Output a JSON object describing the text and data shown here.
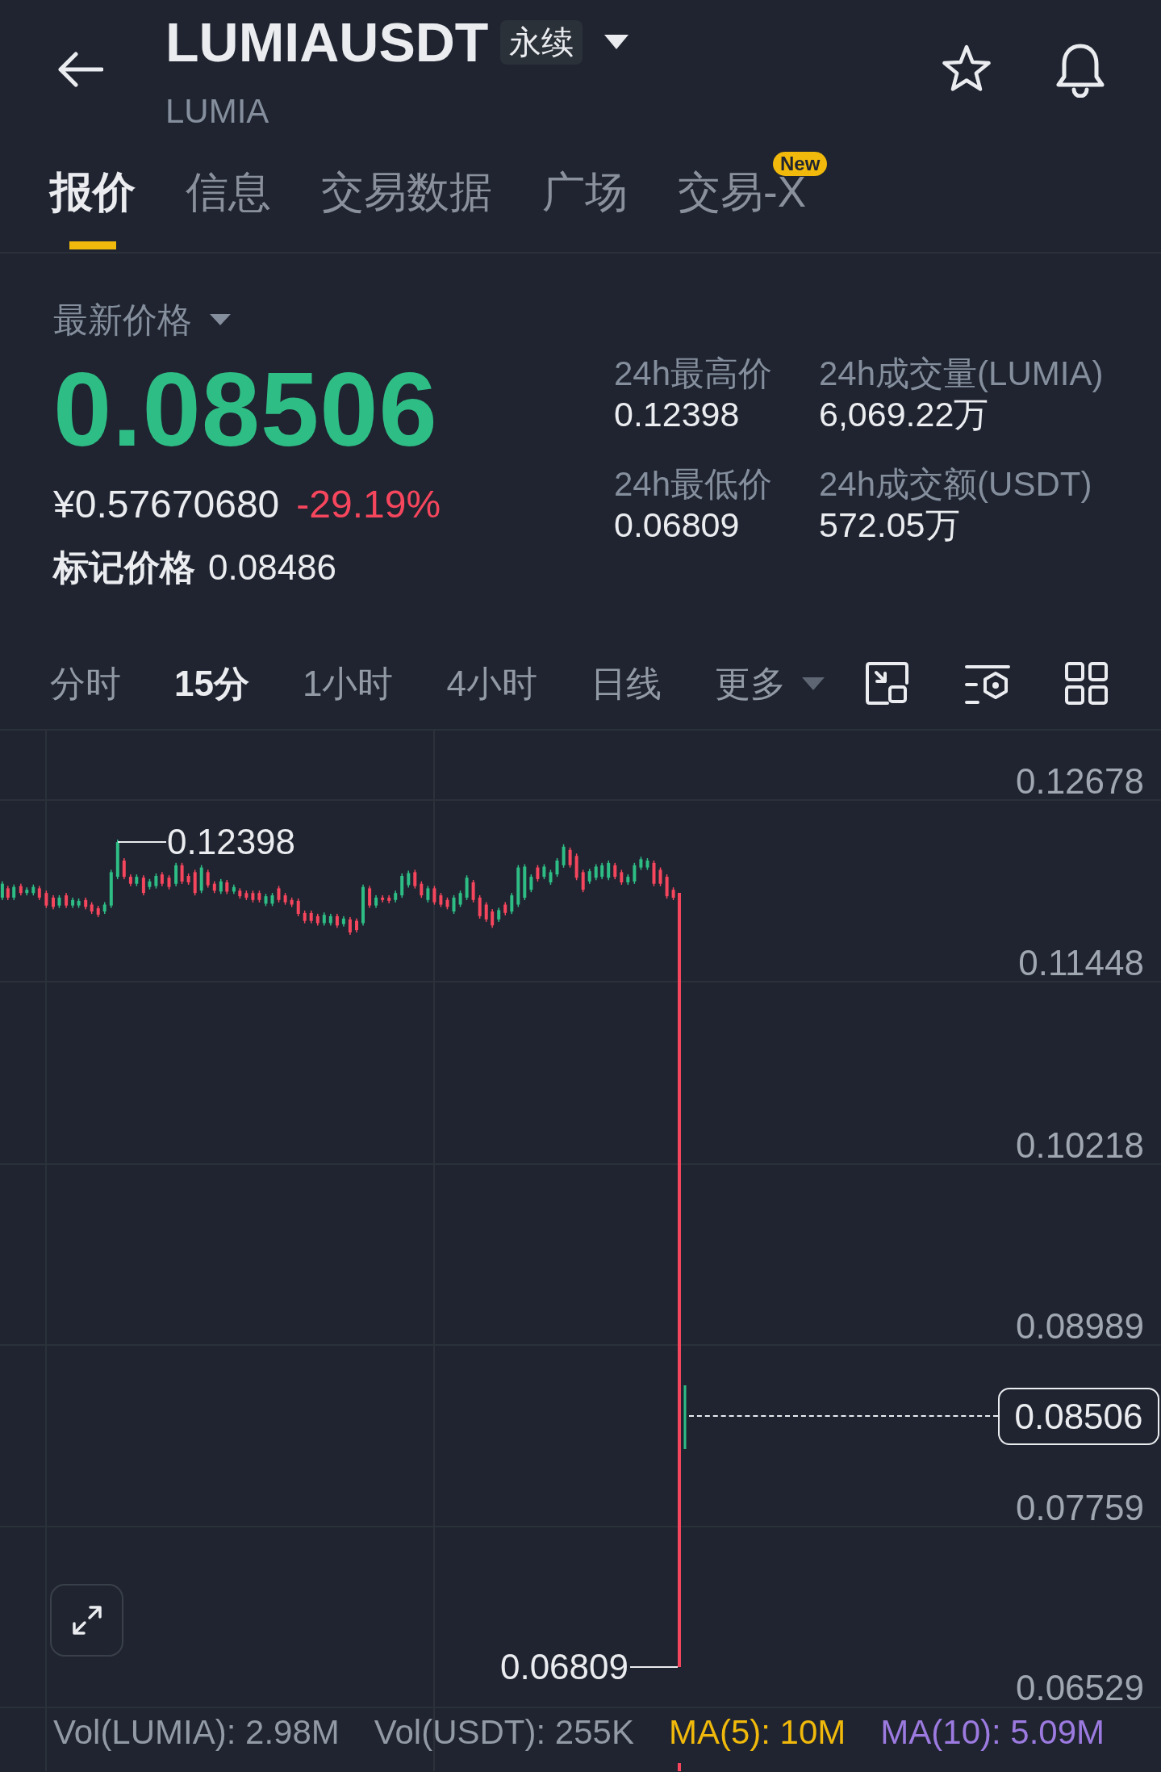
{
  "header": {
    "title": "LUMIAUSDT",
    "badge": "永续",
    "subtitle": "LUMIA"
  },
  "tabs": [
    {
      "label": "报价",
      "selected": true
    },
    {
      "label": "信息",
      "selected": false
    },
    {
      "label": "交易数据",
      "selected": false
    },
    {
      "label": "广场",
      "selected": false
    },
    {
      "label": "交易-X",
      "selected": false,
      "badge": "New"
    }
  ],
  "ticker": {
    "price_label": "最新价格",
    "last_price": "0.08506",
    "last_price_up": true,
    "fiat_price": "¥0.57670680",
    "change": "-29.19%",
    "change_up": false,
    "mark_label": "标记价格",
    "mark_price": "0.08486",
    "stats": [
      {
        "label": "24h最高价",
        "value": "0.12398"
      },
      {
        "label": "24h成交量(LUMIA)",
        "value": "6,069.22万"
      },
      {
        "label": "24h最低价",
        "value": "0.06809"
      },
      {
        "label": "24h成交额(USDT)",
        "value": "572.05万"
      }
    ]
  },
  "intervals": [
    {
      "label": "分时",
      "selected": false,
      "kind": "option"
    },
    {
      "label": "15分",
      "selected": true,
      "kind": "option"
    },
    {
      "label": "1小时",
      "selected": false,
      "kind": "option"
    },
    {
      "label": "4小时",
      "selected": false,
      "kind": "option"
    },
    {
      "label": "日线",
      "selected": false,
      "kind": "option"
    },
    {
      "label": "更多",
      "selected": false,
      "kind": "menu"
    }
  ],
  "chart": {
    "price_axis": [
      "0.12678",
      "0.11448",
      "0.10218",
      "0.08989",
      "0.07759",
      "0.06529"
    ],
    "high_marker": "0.12398",
    "low_marker": "0.06809",
    "current_price": "0.08506"
  },
  "volume_legend": [
    {
      "label": "Vol(LUMIA): 2.98M",
      "color": "#929aa5"
    },
    {
      "label": "Vol(USDT): 255K",
      "color": "#929aa5"
    },
    {
      "label": "MA(5): 10M",
      "color": "#f0b90b"
    },
    {
      "label": "MA(10): 5.09M",
      "color": "#9c7ae0"
    }
  ]
}
